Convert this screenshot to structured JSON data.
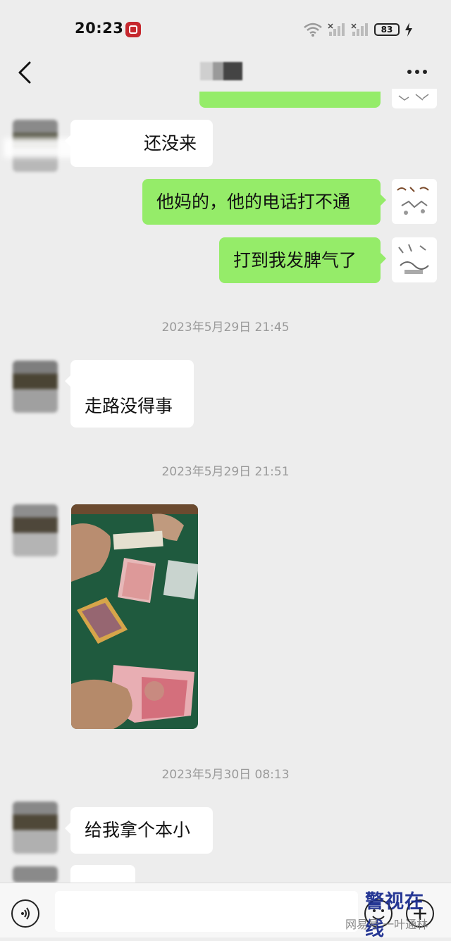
{
  "status_bar": {
    "time": "20:23",
    "battery": "83"
  },
  "messages": [
    {
      "from": "contact",
      "text": "还没来"
    },
    {
      "from": "me",
      "text": "他妈的，他的电话打不通"
    },
    {
      "from": "me",
      "text": "打到我发脾气了"
    },
    {
      "type": "timestamp",
      "text": "2023年5月29日 21:45"
    },
    {
      "from": "contact",
      "text": "走路没得事"
    },
    {
      "type": "timestamp",
      "text": "2023年5月29日 21:51"
    },
    {
      "from": "contact",
      "type": "photo"
    },
    {
      "type": "timestamp",
      "text": "2023年5月30日 08:13"
    },
    {
      "from": "contact",
      "text": "给我拿个本小"
    }
  ],
  "watermark": {
    "logo": "警视在线",
    "source": "网易号 一叶通林"
  }
}
